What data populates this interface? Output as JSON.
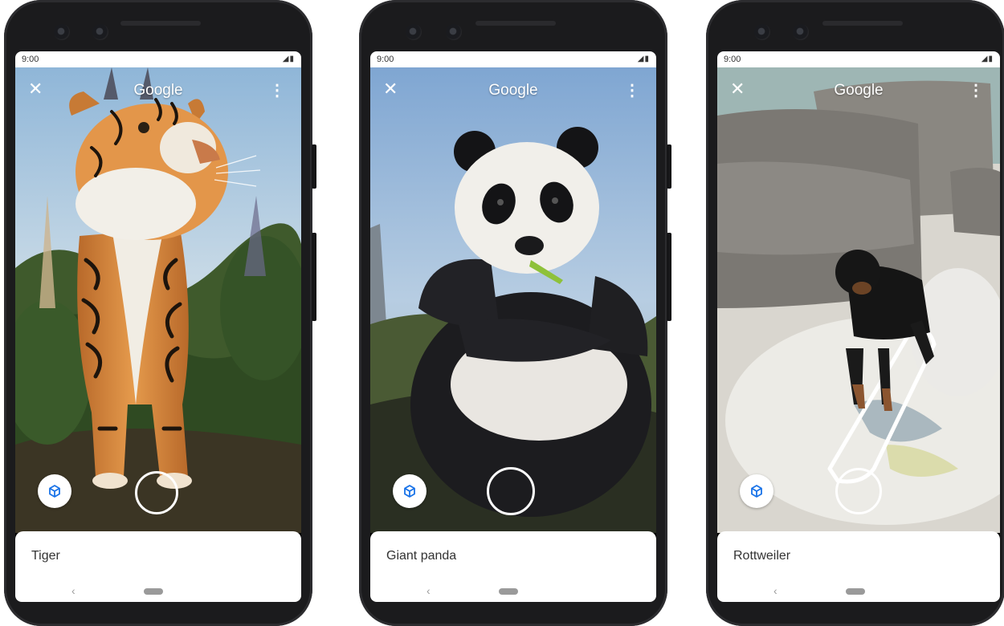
{
  "status": {
    "time": "9:00"
  },
  "topbar": {
    "title": "Google"
  },
  "icons": {
    "close": "close-icon",
    "menu": "more-vert-icon",
    "view3d": "cube-icon",
    "back": "chevron-left-icon"
  },
  "phones": [
    {
      "animal_name": "Tiger"
    },
    {
      "animal_name": "Giant panda"
    },
    {
      "animal_name": "Rottweiler"
    }
  ],
  "colors": {
    "accent_blue": "#1a73e8",
    "sheet_bg": "#ffffff"
  }
}
